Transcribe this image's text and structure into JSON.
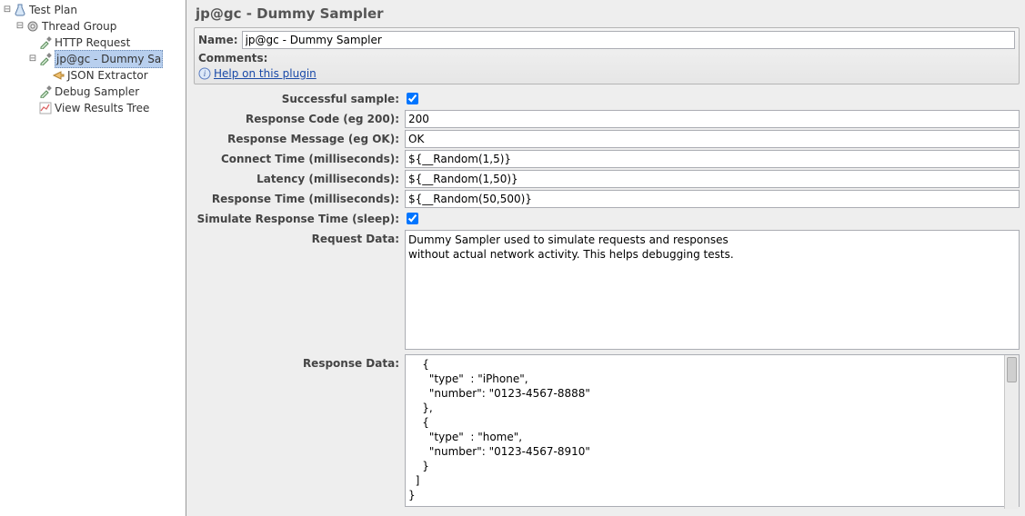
{
  "tree": {
    "items": [
      {
        "label": "Test Plan"
      },
      {
        "label": "Thread Group"
      },
      {
        "label": "HTTP Request"
      },
      {
        "label": "jp@gc - Dummy Sa"
      },
      {
        "label": "JSON Extractor"
      },
      {
        "label": "Debug Sampler"
      },
      {
        "label": "View Results Tree"
      }
    ]
  },
  "panel": {
    "title": "jp@gc - Dummy Sampler",
    "name_label": "Name:",
    "name_value": "jp@gc - Dummy Sampler",
    "comments_label": "Comments:",
    "help_link": "Help on this plugin"
  },
  "form": {
    "successful_label": "Successful sample:",
    "successful_checked": true,
    "response_code_label": "Response Code (eg 200):",
    "response_code_value": "200",
    "response_message_label": "Response Message (eg OK):",
    "response_message_value": "OK",
    "connect_time_label": "Connect Time (milliseconds):",
    "connect_time_value": "${__Random(1,5)}",
    "latency_label": "Latency (milliseconds):",
    "latency_value": "${__Random(1,50)}",
    "response_time_label": "Response Time (milliseconds):",
    "response_time_value": "${__Random(50,500)}",
    "simulate_label": "Simulate Response Time (sleep):",
    "simulate_checked": true,
    "request_data_label": "Request Data:",
    "request_data_value": "Dummy Sampler used to simulate requests and responses\nwithout actual network activity. This helps debugging tests.",
    "response_data_label": "Response Data:",
    "response_data_value": "    {\n      \"type\"  : \"iPhone\",\n      \"number\": \"0123-4567-8888\"\n    },\n    {\n      \"type\"  : \"home\",\n      \"number\": \"0123-4567-8910\"\n    }\n  ]\n}"
  }
}
